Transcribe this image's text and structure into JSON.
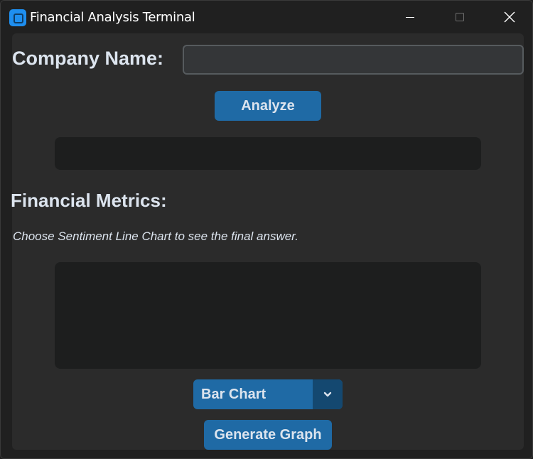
{
  "window": {
    "title": "Financial Analysis Terminal",
    "icon": "app-icon",
    "controls": [
      "minimize-icon",
      "maximize-icon",
      "close-icon"
    ]
  },
  "form": {
    "company_label": "Company Name:",
    "company_value": "",
    "company_placeholder": "",
    "analyze_label": "Analyze"
  },
  "result": {
    "text": ""
  },
  "metrics": {
    "heading": "Financial Metrics:",
    "hint": "Choose Sentiment Line Chart to see the final answer.",
    "content": ""
  },
  "graph": {
    "chart_type_selected": "Bar Chart",
    "generate_label": "Generate Graph"
  },
  "colors": {
    "accent": "#1f6aa5",
    "accent_dark": "#144870",
    "panel": "#2b2b2b",
    "textbox": "#1d1e1e",
    "text": "#dce4ee"
  }
}
